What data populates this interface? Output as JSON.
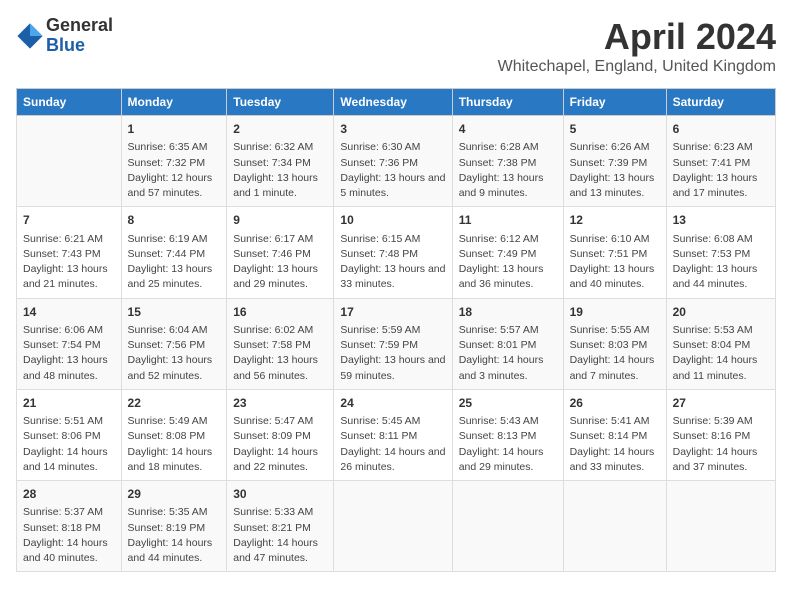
{
  "logo": {
    "general": "General",
    "blue": "Blue"
  },
  "title": "April 2024",
  "subtitle": "Whitechapel, England, United Kingdom",
  "headers": [
    "Sunday",
    "Monday",
    "Tuesday",
    "Wednesday",
    "Thursday",
    "Friday",
    "Saturday"
  ],
  "weeks": [
    [
      {
        "day": "",
        "sunrise": "",
        "sunset": "",
        "daylight": ""
      },
      {
        "day": "1",
        "sunrise": "Sunrise: 6:35 AM",
        "sunset": "Sunset: 7:32 PM",
        "daylight": "Daylight: 12 hours and 57 minutes."
      },
      {
        "day": "2",
        "sunrise": "Sunrise: 6:32 AM",
        "sunset": "Sunset: 7:34 PM",
        "daylight": "Daylight: 13 hours and 1 minute."
      },
      {
        "day": "3",
        "sunrise": "Sunrise: 6:30 AM",
        "sunset": "Sunset: 7:36 PM",
        "daylight": "Daylight: 13 hours and 5 minutes."
      },
      {
        "day": "4",
        "sunrise": "Sunrise: 6:28 AM",
        "sunset": "Sunset: 7:38 PM",
        "daylight": "Daylight: 13 hours and 9 minutes."
      },
      {
        "day": "5",
        "sunrise": "Sunrise: 6:26 AM",
        "sunset": "Sunset: 7:39 PM",
        "daylight": "Daylight: 13 hours and 13 minutes."
      },
      {
        "day": "6",
        "sunrise": "Sunrise: 6:23 AM",
        "sunset": "Sunset: 7:41 PM",
        "daylight": "Daylight: 13 hours and 17 minutes."
      }
    ],
    [
      {
        "day": "7",
        "sunrise": "Sunrise: 6:21 AM",
        "sunset": "Sunset: 7:43 PM",
        "daylight": "Daylight: 13 hours and 21 minutes."
      },
      {
        "day": "8",
        "sunrise": "Sunrise: 6:19 AM",
        "sunset": "Sunset: 7:44 PM",
        "daylight": "Daylight: 13 hours and 25 minutes."
      },
      {
        "day": "9",
        "sunrise": "Sunrise: 6:17 AM",
        "sunset": "Sunset: 7:46 PM",
        "daylight": "Daylight: 13 hours and 29 minutes."
      },
      {
        "day": "10",
        "sunrise": "Sunrise: 6:15 AM",
        "sunset": "Sunset: 7:48 PM",
        "daylight": "Daylight: 13 hours and 33 minutes."
      },
      {
        "day": "11",
        "sunrise": "Sunrise: 6:12 AM",
        "sunset": "Sunset: 7:49 PM",
        "daylight": "Daylight: 13 hours and 36 minutes."
      },
      {
        "day": "12",
        "sunrise": "Sunrise: 6:10 AM",
        "sunset": "Sunset: 7:51 PM",
        "daylight": "Daylight: 13 hours and 40 minutes."
      },
      {
        "day": "13",
        "sunrise": "Sunrise: 6:08 AM",
        "sunset": "Sunset: 7:53 PM",
        "daylight": "Daylight: 13 hours and 44 minutes."
      }
    ],
    [
      {
        "day": "14",
        "sunrise": "Sunrise: 6:06 AM",
        "sunset": "Sunset: 7:54 PM",
        "daylight": "Daylight: 13 hours and 48 minutes."
      },
      {
        "day": "15",
        "sunrise": "Sunrise: 6:04 AM",
        "sunset": "Sunset: 7:56 PM",
        "daylight": "Daylight: 13 hours and 52 minutes."
      },
      {
        "day": "16",
        "sunrise": "Sunrise: 6:02 AM",
        "sunset": "Sunset: 7:58 PM",
        "daylight": "Daylight: 13 hours and 56 minutes."
      },
      {
        "day": "17",
        "sunrise": "Sunrise: 5:59 AM",
        "sunset": "Sunset: 7:59 PM",
        "daylight": "Daylight: 13 hours and 59 minutes."
      },
      {
        "day": "18",
        "sunrise": "Sunrise: 5:57 AM",
        "sunset": "Sunset: 8:01 PM",
        "daylight": "Daylight: 14 hours and 3 minutes."
      },
      {
        "day": "19",
        "sunrise": "Sunrise: 5:55 AM",
        "sunset": "Sunset: 8:03 PM",
        "daylight": "Daylight: 14 hours and 7 minutes."
      },
      {
        "day": "20",
        "sunrise": "Sunrise: 5:53 AM",
        "sunset": "Sunset: 8:04 PM",
        "daylight": "Daylight: 14 hours and 11 minutes."
      }
    ],
    [
      {
        "day": "21",
        "sunrise": "Sunrise: 5:51 AM",
        "sunset": "Sunset: 8:06 PM",
        "daylight": "Daylight: 14 hours and 14 minutes."
      },
      {
        "day": "22",
        "sunrise": "Sunrise: 5:49 AM",
        "sunset": "Sunset: 8:08 PM",
        "daylight": "Daylight: 14 hours and 18 minutes."
      },
      {
        "day": "23",
        "sunrise": "Sunrise: 5:47 AM",
        "sunset": "Sunset: 8:09 PM",
        "daylight": "Daylight: 14 hours and 22 minutes."
      },
      {
        "day": "24",
        "sunrise": "Sunrise: 5:45 AM",
        "sunset": "Sunset: 8:11 PM",
        "daylight": "Daylight: 14 hours and 26 minutes."
      },
      {
        "day": "25",
        "sunrise": "Sunrise: 5:43 AM",
        "sunset": "Sunset: 8:13 PM",
        "daylight": "Daylight: 14 hours and 29 minutes."
      },
      {
        "day": "26",
        "sunrise": "Sunrise: 5:41 AM",
        "sunset": "Sunset: 8:14 PM",
        "daylight": "Daylight: 14 hours and 33 minutes."
      },
      {
        "day": "27",
        "sunrise": "Sunrise: 5:39 AM",
        "sunset": "Sunset: 8:16 PM",
        "daylight": "Daylight: 14 hours and 37 minutes."
      }
    ],
    [
      {
        "day": "28",
        "sunrise": "Sunrise: 5:37 AM",
        "sunset": "Sunset: 8:18 PM",
        "daylight": "Daylight: 14 hours and 40 minutes."
      },
      {
        "day": "29",
        "sunrise": "Sunrise: 5:35 AM",
        "sunset": "Sunset: 8:19 PM",
        "daylight": "Daylight: 14 hours and 44 minutes."
      },
      {
        "day": "30",
        "sunrise": "Sunrise: 5:33 AM",
        "sunset": "Sunset: 8:21 PM",
        "daylight": "Daylight: 14 hours and 47 minutes."
      },
      {
        "day": "",
        "sunrise": "",
        "sunset": "",
        "daylight": ""
      },
      {
        "day": "",
        "sunrise": "",
        "sunset": "",
        "daylight": ""
      },
      {
        "day": "",
        "sunrise": "",
        "sunset": "",
        "daylight": ""
      },
      {
        "day": "",
        "sunrise": "",
        "sunset": "",
        "daylight": ""
      }
    ]
  ]
}
